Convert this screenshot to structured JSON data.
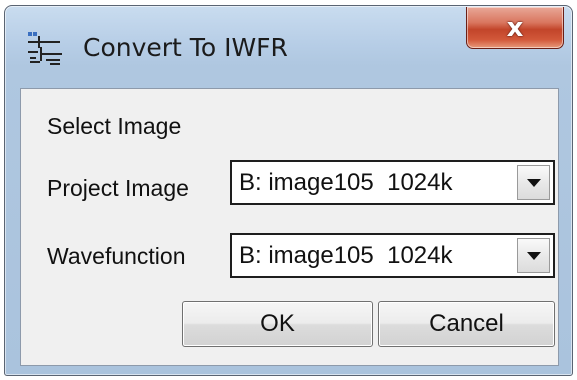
{
  "window": {
    "title": "Convert To IWFR",
    "close_glyph": "x",
    "icon": "app-icon"
  },
  "dialog": {
    "section_label": "Select Image",
    "project_image": {
      "label": "Project Image",
      "value": "B: image105  1024k"
    },
    "wavefunction": {
      "label": "Wavefunction",
      "value": "B: image105  1024k"
    },
    "ok_label": "OK",
    "cancel_label": "Cancel"
  },
  "colors": {
    "close_button": "#c2452a",
    "frame": "#b6cde6",
    "client": "#f0f0f0"
  }
}
